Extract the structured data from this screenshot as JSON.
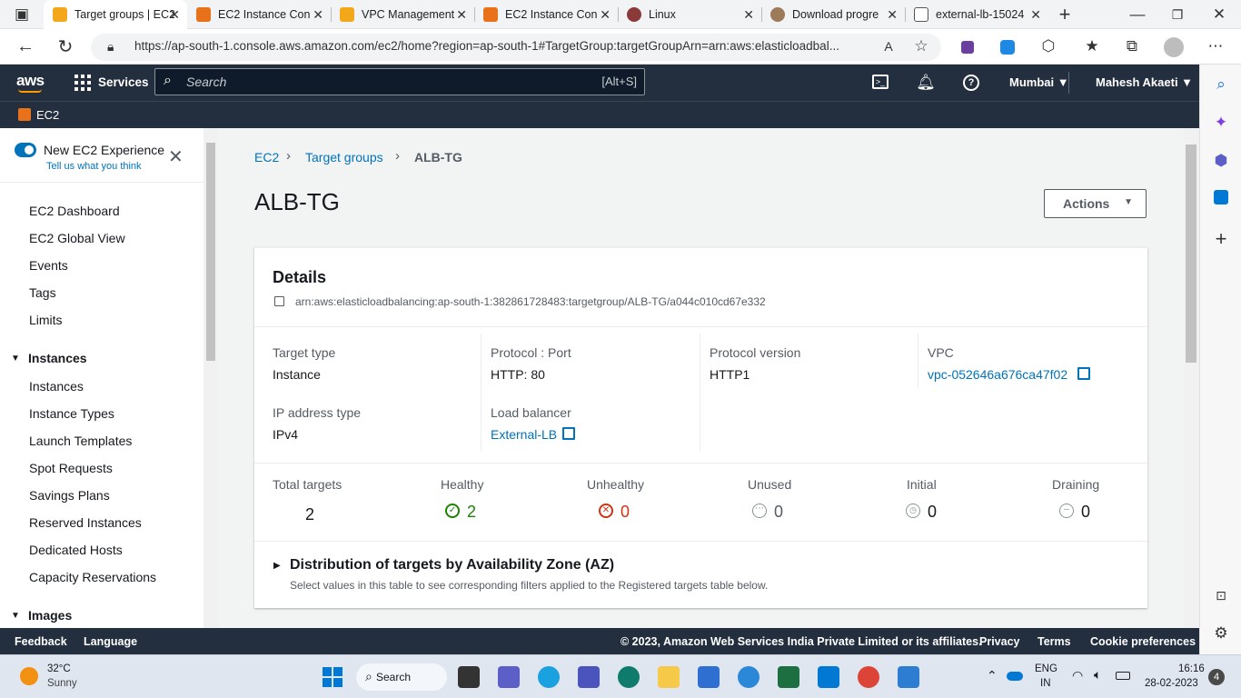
{
  "browser": {
    "tabs": [
      {
        "label": "Target groups | EC2",
        "color": "#f3a81c"
      },
      {
        "label": "EC2 Instance Con",
        "color": "#e8711a"
      },
      {
        "label": "VPC Management",
        "color": "#f3a81c"
      },
      {
        "label": "EC2 Instance Con",
        "color": "#e8711a"
      },
      {
        "label": "Linux",
        "color": "#8b3a3a"
      },
      {
        "label": "Download progre",
        "color": "#9c7a5a"
      },
      {
        "label": "external-lb-15024",
        "color": "#555555"
      }
    ],
    "url": "https://ap-south-1.console.aws.amazon.com/ec2/home?region=ap-south-1#TargetGroup:targetGroupArn=arn:aws:elasticloadbal..."
  },
  "aws_nav": {
    "services_label": "Services",
    "search_placeholder": "Search",
    "search_shortcut": "[Alt+S]",
    "region": "Mumbai ▼",
    "user": "Mahesh Akaeti ▼",
    "service_badge": "EC2"
  },
  "sidebar": {
    "toggle_label": "New EC2 Experience",
    "feedback_link": "Tell us what you think",
    "items": [
      "EC2 Dashboard",
      "EC2 Global View",
      "Events",
      "Tags",
      "Limits"
    ],
    "instances_header": "Instances",
    "instance_items": [
      "Instances",
      "Instance Types",
      "Launch Templates",
      "Spot Requests",
      "Savings Plans",
      "Reserved Instances",
      "Dedicated Hosts",
      "Capacity Reservations"
    ],
    "images_header": "Images"
  },
  "breadcrumb": {
    "root": "EC2",
    "parent": "Target groups",
    "current": "ALB-TG"
  },
  "page": {
    "title": "ALB-TG",
    "actions_label": "Actions"
  },
  "details": {
    "heading": "Details",
    "arn": "arn:aws:elasticloadbalancing:ap-south-1:382861728483:targetgroup/ALB-TG/a044c010cd67e332",
    "target_type_label": "Target type",
    "target_type": "Instance",
    "protocol_port_label": "Protocol : Port",
    "protocol_port": "HTTP: 80",
    "protocol_version_label": "Protocol version",
    "protocol_version": "HTTP1",
    "vpc_label": "VPC",
    "vpc": "vpc-052646a676ca47f02",
    "ip_type_label": "IP address type",
    "ip_type": "IPv4",
    "lb_label": "Load balancer",
    "lb": "External-LB"
  },
  "stats": {
    "total_label": "Total targets",
    "total": "2",
    "healthy_label": "Healthy",
    "healthy": "2",
    "unhealthy_label": "Unhealthy",
    "unhealthy": "0",
    "unused_label": "Unused",
    "unused": "0",
    "initial_label": "Initial",
    "initial": "0",
    "draining_label": "Draining",
    "draining": "0"
  },
  "distribution": {
    "heading": "Distribution of targets by Availability Zone (AZ)",
    "description": "Select values in this table to see corresponding filters applied to the Registered targets table below."
  },
  "footer": {
    "feedback": "Feedback",
    "language": "Language",
    "copyright": "© 2023, Amazon Web Services India Private Limited or its affiliates.",
    "privacy": "Privacy",
    "terms": "Terms",
    "cookies": "Cookie preferences"
  },
  "taskbar": {
    "temp": "32°C",
    "weather": "Sunny",
    "search": "Search",
    "lang1": "ENG",
    "lang2": "IN",
    "time": "16:16",
    "date": "28-02-2023",
    "notif": "4"
  },
  "colors": {
    "aws_dark": "#232f3e",
    "link": "#0073bb",
    "healthy": "#1d8102",
    "unhealthy": "#d13212"
  }
}
